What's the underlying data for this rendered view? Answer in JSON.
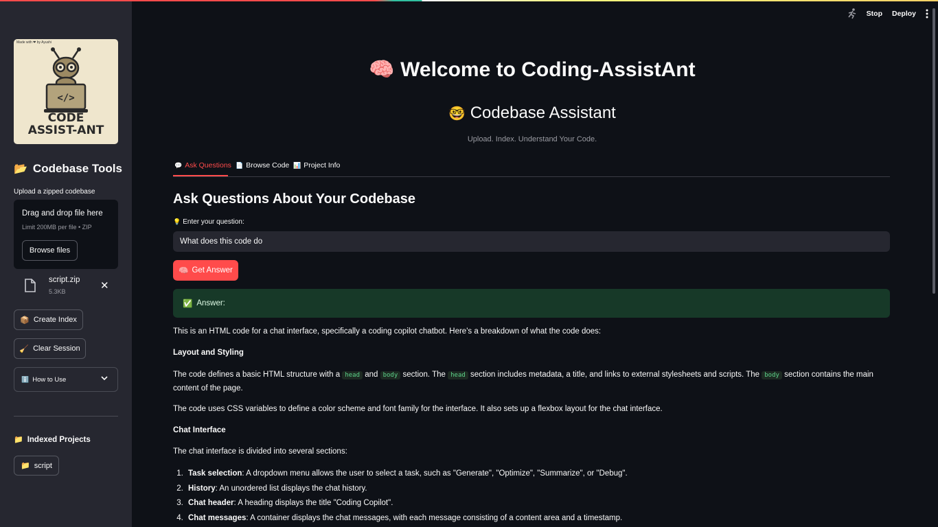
{
  "sidebar": {
    "logo": {
      "made_with": "Made with ❤ by Ayushi",
      "line1": "CODE",
      "line2": "ASSIST-ANT"
    },
    "heading": "Codebase Tools",
    "upload_label": "Upload a zipped codebase",
    "dropzone": {
      "title": "Drag and drop file here",
      "limit": "Limit 200MB per file • ZIP",
      "browse_label": "Browse files"
    },
    "file": {
      "name": "script.zip",
      "size": "5.3KB"
    },
    "create_index_label": "Create Index",
    "clear_session_label": "Clear Session",
    "how_to_use_label": "How to Use",
    "indexed_projects_label": "Indexed Projects",
    "project_label": "script"
  },
  "header": {
    "stop_label": "Stop",
    "deploy_label": "Deploy"
  },
  "main": {
    "title": "Welcome to Coding-AssistAnt",
    "subtitle": "Codebase Assistant",
    "caption": "Upload. Index. Understand Your Code.",
    "tabs": [
      {
        "label": "Ask Questions"
      },
      {
        "label": "Browse Code"
      },
      {
        "label": "Project Info"
      }
    ],
    "section_title": "Ask Questions About Your Codebase",
    "question_label": "Enter your question:",
    "question_value": "What does this code do",
    "get_answer_label": "Get Answer",
    "answer_label": "Answer:",
    "answer": {
      "intro": "This is an HTML code for a chat interface, specifically a coding copilot chatbot. Here's a breakdown of what the code does:",
      "h_layout": "Layout and Styling",
      "p1_a": "The code defines a basic HTML structure with a",
      "code_head": "head",
      "p1_and": "and",
      "code_body": "body",
      "p1_b": "section. The",
      "p1_c": "section includes metadata, a title, and links to external stylesheets and scripts. The",
      "p1_d": "section contains the main content of the page.",
      "p2": "The code uses CSS variables to define a color scheme and font family for the interface. It also sets up a flexbox layout for the chat interface.",
      "h_chat": "Chat Interface",
      "p3": "The chat interface is divided into several sections:",
      "list": [
        {
          "term": "Task selection",
          "desc": ": A dropdown menu allows the user to select a task, such as \"Generate\", \"Optimize\", \"Summarize\", or \"Debug\"."
        },
        {
          "term": "History",
          "desc": ": An unordered list displays the chat history."
        },
        {
          "term": "Chat header",
          "desc": ": A heading displays the title \"Coding Copilot\"."
        },
        {
          "term": "Chat messages",
          "desc": ": A container displays the chat messages, with each message consisting of a content area and a timestamp."
        }
      ]
    }
  },
  "colors": {
    "accent": "#ff4b4b",
    "sidebar_bg": "#262730",
    "page_bg": "#0e1117",
    "success_bg": "#173928"
  }
}
